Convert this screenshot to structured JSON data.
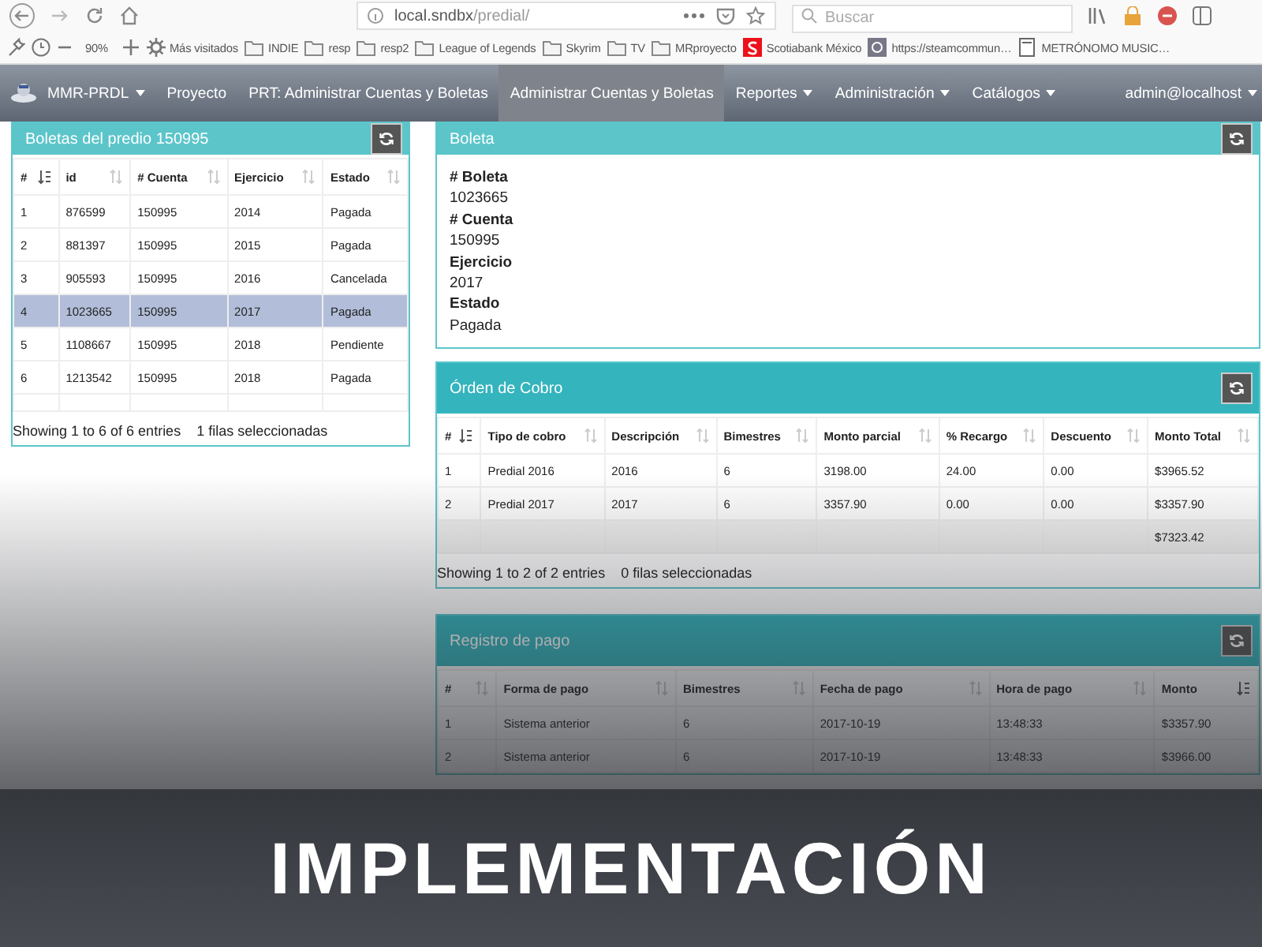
{
  "browser": {
    "url_host": "local.sndbx",
    "url_path": "/predial/",
    "search": {
      "placeholder": "Buscar"
    },
    "zoom": "90%",
    "bookmarks": [
      {
        "label": "Más visitados",
        "kind": "gear"
      },
      {
        "label": "INDIE",
        "kind": "folder"
      },
      {
        "label": "resp",
        "kind": "folder"
      },
      {
        "label": "resp2",
        "kind": "folder"
      },
      {
        "label": "League of Legends",
        "kind": "folder"
      },
      {
        "label": "Skyrim",
        "kind": "folder"
      },
      {
        "label": "TV",
        "kind": "folder"
      },
      {
        "label": "MRproyecto",
        "kind": "folder"
      },
      {
        "label": "Scotiabank México",
        "kind": "bank"
      },
      {
        "label": "https://steamcommun…",
        "kind": "site"
      },
      {
        "label": "METRÓNOMO MUSIC…",
        "kind": "page"
      }
    ]
  },
  "navbar": {
    "brand": {
      "label": "MMR-PRDL",
      "dropdown": true
    },
    "items": [
      {
        "label": "Proyecto",
        "dropdown": false,
        "selected": false
      },
      {
        "label": "PRT: Administrar Cuentas y Boletas",
        "dropdown": false,
        "selected": false
      },
      {
        "label": "Administrar Cuentas y Boletas",
        "dropdown": false,
        "selected": true
      },
      {
        "label": "Reportes",
        "dropdown": true,
        "selected": false
      },
      {
        "label": "Administración",
        "dropdown": true,
        "selected": false
      },
      {
        "label": "Catálogos",
        "dropdown": true,
        "selected": false
      }
    ],
    "user": {
      "label": "admin@localhost",
      "dropdown": true
    }
  },
  "boletas": {
    "title": "Boletas del predio 150995",
    "columns": [
      {
        "label": "#",
        "kind": "sorted"
      },
      {
        "label": "id",
        "kind": "sortable"
      },
      {
        "label": "# Cuenta",
        "kind": "sortable"
      },
      {
        "label": "Ejercicio",
        "kind": "sortable"
      },
      {
        "label": "Estado",
        "kind": "sortable"
      }
    ],
    "rows": [
      {
        "cells": [
          "1",
          "876599",
          "150995",
          "2014",
          "Pagada"
        ],
        "selected": false
      },
      {
        "cells": [
          "2",
          "881397",
          "150995",
          "2015",
          "Pagada"
        ],
        "selected": false
      },
      {
        "cells": [
          "3",
          "905593",
          "150995",
          "2016",
          "Cancelada"
        ],
        "selected": false
      },
      {
        "cells": [
          "4",
          "1023665",
          "150995",
          "2017",
          "Pagada"
        ],
        "selected": true
      },
      {
        "cells": [
          "5",
          "1108667",
          "150995",
          "2018",
          "Pendiente"
        ],
        "selected": false
      },
      {
        "cells": [
          "6",
          "1213542",
          "150995",
          "2018",
          "Pagada"
        ],
        "selected": false
      }
    ],
    "info": "Showing 1 to 6 of 6 entries",
    "selection_info": "1 filas seleccionadas"
  },
  "boleta": {
    "title": "Boleta",
    "fields": [
      {
        "label": "# Boleta",
        "value": "1023665"
      },
      {
        "label": "# Cuenta",
        "value": "150995"
      },
      {
        "label": "Ejercicio",
        "value": "2017"
      },
      {
        "label": "Estado",
        "value": "Pagada"
      }
    ]
  },
  "orden": {
    "title": "Órden de Cobro",
    "columns": [
      {
        "label": "#",
        "kind": "sorted"
      },
      {
        "label": "Tipo de cobro",
        "kind": "sortable"
      },
      {
        "label": "Descripción",
        "kind": "sortable"
      },
      {
        "label": "Bimestres",
        "kind": "sortable"
      },
      {
        "label": "Monto parcial",
        "kind": "sortable"
      },
      {
        "label": "% Recargo",
        "kind": "sortable"
      },
      {
        "label": "Descuento",
        "kind": "sortable"
      },
      {
        "label": "Monto Total",
        "kind": "sortable"
      }
    ],
    "rows": [
      {
        "cells": [
          "1",
          "Predial 2016",
          "2016",
          "6",
          "3198.00",
          "24.00",
          "0.00",
          "$3965.52"
        ]
      },
      {
        "cells": [
          "2",
          "Predial 2017",
          "2017",
          "6",
          "3357.90",
          "0.00",
          "0.00",
          "$3357.90"
        ]
      }
    ],
    "total": "$7323.42",
    "info": "Showing 1 to 2 of 2 entries",
    "selection_info": "0 filas seleccionadas"
  },
  "registro": {
    "title": "Registro de pago",
    "columns": [
      {
        "label": "#",
        "kind": "sortable"
      },
      {
        "label": "Forma de pago",
        "kind": "sortable"
      },
      {
        "label": "Bimestres",
        "kind": "sortable"
      },
      {
        "label": "Fecha de pago",
        "kind": "sortable"
      },
      {
        "label": "Hora de pago",
        "kind": "sortable"
      },
      {
        "label": "Monto",
        "kind": "sorted"
      }
    ],
    "rows": [
      {
        "cells": [
          "1",
          "Sistema anterior",
          "6",
          "2017-10-19",
          "13:48:33",
          "$3357.90"
        ]
      },
      {
        "cells": [
          "2",
          "Sistema anterior",
          "6",
          "2017-10-19",
          "13:48:33",
          "$3966.00"
        ]
      }
    ]
  },
  "banner": {
    "title": "IMPLEMENTACIÓN"
  }
}
